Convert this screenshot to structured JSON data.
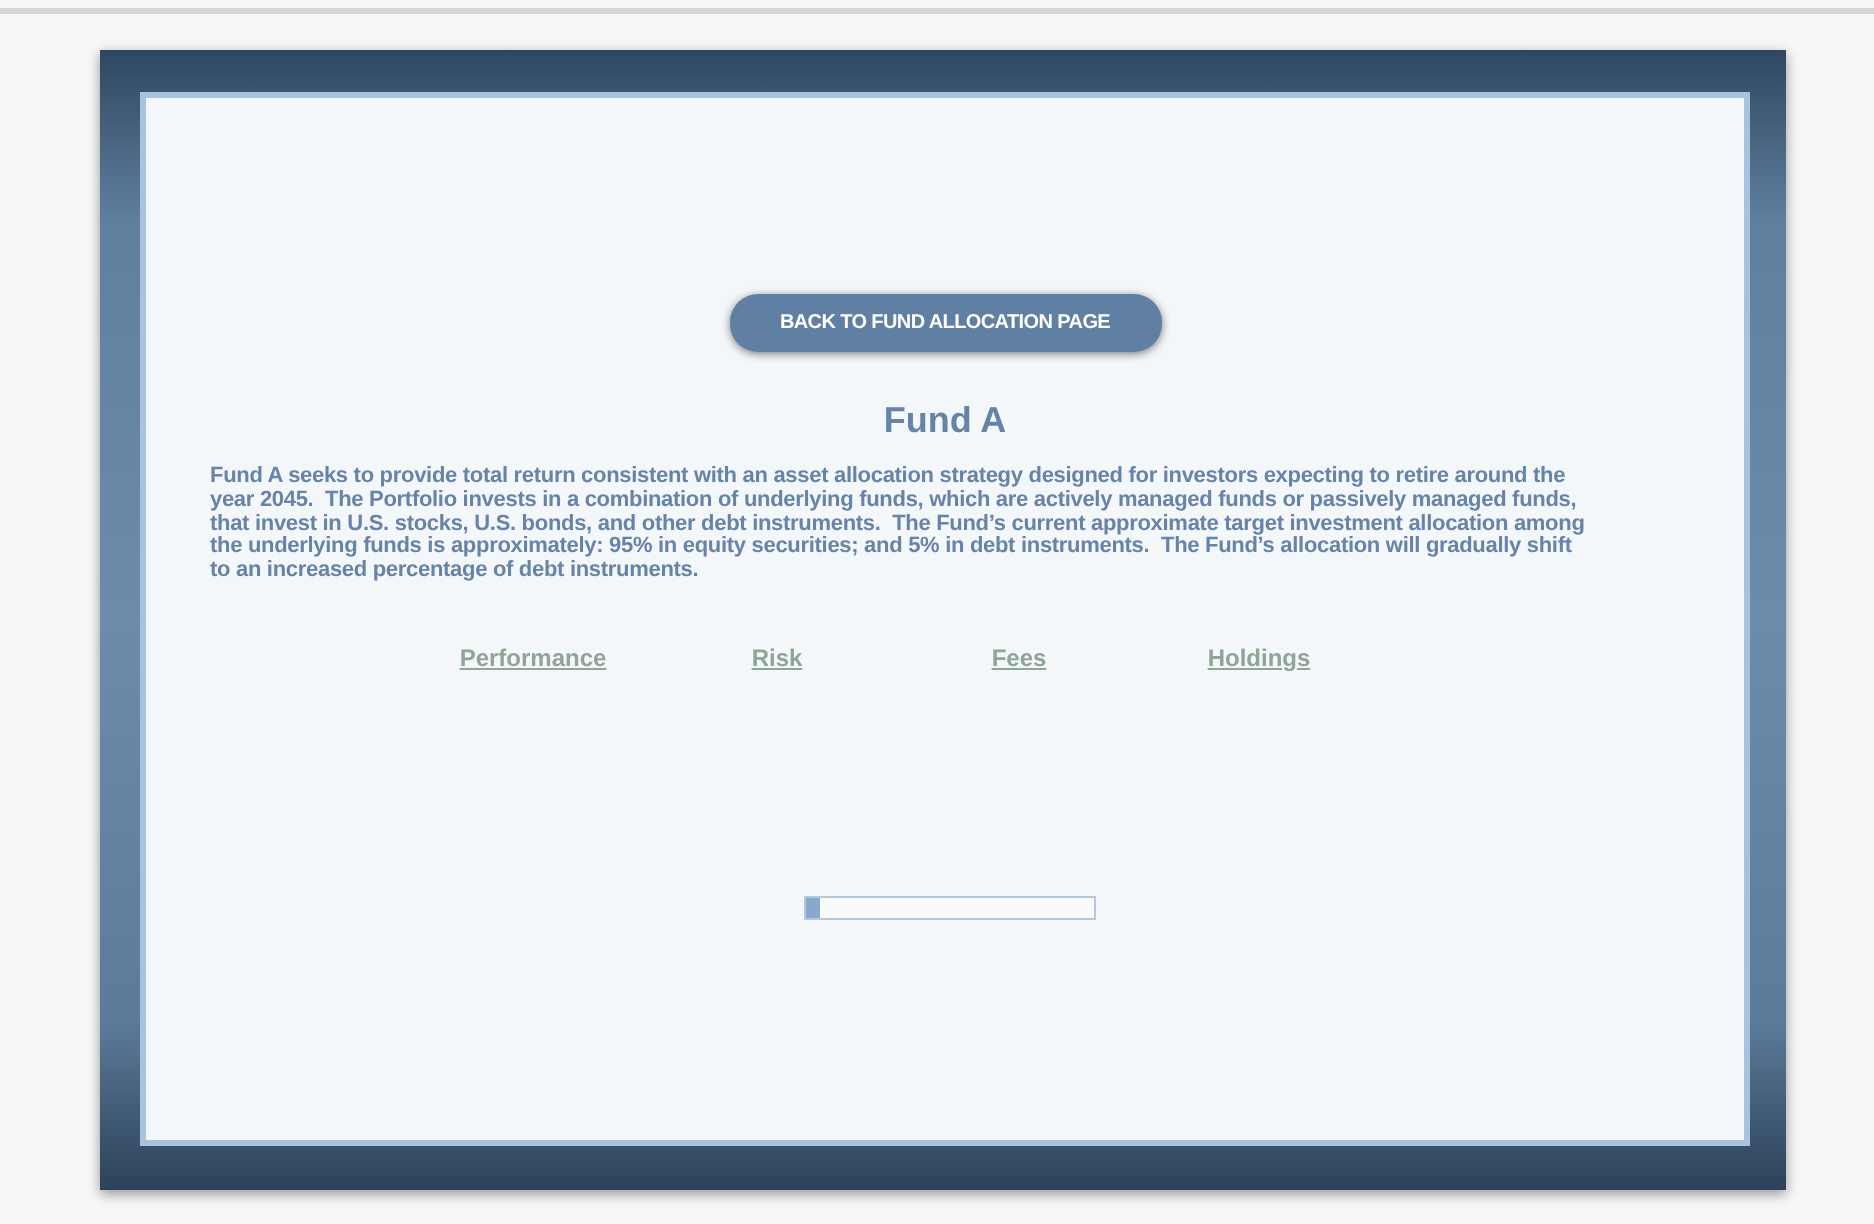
{
  "back_button": {
    "label": "BACK TO FUND ALLOCATION PAGE"
  },
  "title": "Fund A",
  "description": "Fund A seeks to provide total return consistent with an asset allocation strategy designed for investors expecting to retire around the year 2045.  The Portfolio invests in a combination of underlying funds, which are actively managed funds or passively managed funds, that invest in U.S. stocks, U.S. bonds, and other debt instruments.  The Fund’s current approximate target investment allocation among the underlying funds is approximately: 95% in equity securities; and 5% in debt instruments.  The Fund’s allocation will gradually shift to an increased percentage of debt instruments.",
  "links": [
    {
      "label": "Performance"
    },
    {
      "label": "Risk"
    },
    {
      "label": "Fees"
    },
    {
      "label": "Holdings"
    }
  ],
  "progress": {
    "level": 0.05
  }
}
